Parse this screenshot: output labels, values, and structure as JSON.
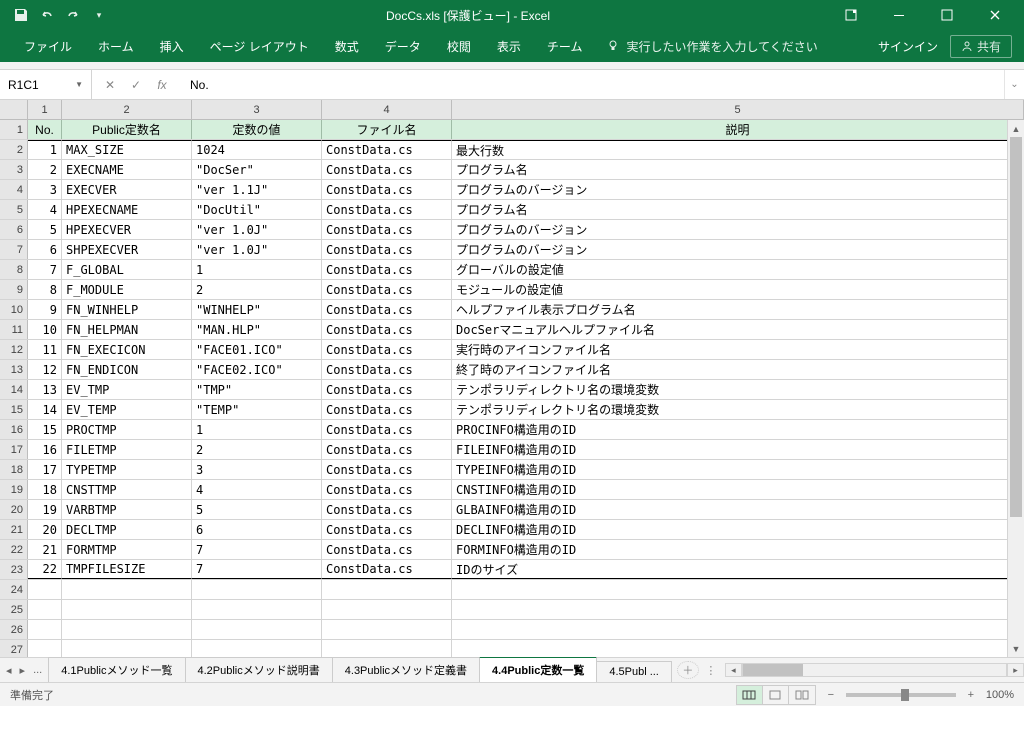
{
  "title": "DocCs.xls  [保護ビュー] - Excel",
  "qat": {
    "save": "保存",
    "undo": "元に戻す",
    "redo": "やり直し"
  },
  "ribbon": {
    "tabs": [
      "ファイル",
      "ホーム",
      "挿入",
      "ページ レイアウト",
      "数式",
      "データ",
      "校閲",
      "表示",
      "チーム"
    ],
    "tellme": "実行したい作業を入力してください",
    "signin": "サインイン",
    "share": "共有"
  },
  "name_box": "R1C1",
  "formula": "No.",
  "columns": [
    "1",
    "2",
    "3",
    "4",
    "5"
  ],
  "headers": [
    "No.",
    "Public定数名",
    "定数の値",
    "ファイル名",
    "説明"
  ],
  "rows": [
    {
      "no": "1",
      "name": "MAX_SIZE",
      "value": "1024",
      "file": "ConstData.cs",
      "desc": "最大行数"
    },
    {
      "no": "2",
      "name": "EXECNAME",
      "value": "\"DocSer\"",
      "file": "ConstData.cs",
      "desc": "プログラム名"
    },
    {
      "no": "3",
      "name": "EXECVER",
      "value": "\"ver 1.1J\"",
      "file": "ConstData.cs",
      "desc": "プログラムのバージョン"
    },
    {
      "no": "4",
      "name": "HPEXECNAME",
      "value": "\"DocUtil\"",
      "file": "ConstData.cs",
      "desc": "プログラム名"
    },
    {
      "no": "5",
      "name": "HPEXECVER",
      "value": "\"ver 1.0J\"",
      "file": "ConstData.cs",
      "desc": "プログラムのバージョン"
    },
    {
      "no": "6",
      "name": "SHPEXECVER",
      "value": "\"ver 1.0J\"",
      "file": "ConstData.cs",
      "desc": "プログラムのバージョン"
    },
    {
      "no": "7",
      "name": "F_GLOBAL",
      "value": "1",
      "file": "ConstData.cs",
      "desc": "グローバルの設定値"
    },
    {
      "no": "8",
      "name": "F_MODULE",
      "value": "2",
      "file": "ConstData.cs",
      "desc": "モジュールの設定値"
    },
    {
      "no": "9",
      "name": "FN_WINHELP",
      "value": "\"WINHELP\"",
      "file": "ConstData.cs",
      "desc": "ヘルプファイル表示プログラム名"
    },
    {
      "no": "10",
      "name": "FN_HELPMAN",
      "value": "\"MAN.HLP\"",
      "file": "ConstData.cs",
      "desc": "DocSerマニュアルヘルプファイル名"
    },
    {
      "no": "11",
      "name": "FN_EXECICON",
      "value": "\"FACE01.ICO\"",
      "file": "ConstData.cs",
      "desc": "実行時のアイコンファイル名"
    },
    {
      "no": "12",
      "name": "FN_ENDICON",
      "value": "\"FACE02.ICO\"",
      "file": "ConstData.cs",
      "desc": "終了時のアイコンファイル名"
    },
    {
      "no": "13",
      "name": "EV_TMP",
      "value": "\"TMP\"",
      "file": "ConstData.cs",
      "desc": "テンポラリディレクトリ名の環境変数"
    },
    {
      "no": "14",
      "name": "EV_TEMP",
      "value": "\"TEMP\"",
      "file": "ConstData.cs",
      "desc": "テンポラリディレクトリ名の環境変数"
    },
    {
      "no": "15",
      "name": "PROCTMP",
      "value": "1",
      "file": "ConstData.cs",
      "desc": "PROCINFO構造用のID"
    },
    {
      "no": "16",
      "name": "FILETMP",
      "value": "2",
      "file": "ConstData.cs",
      "desc": "FILEINFO構造用のID"
    },
    {
      "no": "17",
      "name": "TYPETMP",
      "value": "3",
      "file": "ConstData.cs",
      "desc": "TYPEINFO構造用のID"
    },
    {
      "no": "18",
      "name": "CNSTTMP",
      "value": "4",
      "file": "ConstData.cs",
      "desc": "CNSTINFO構造用のID"
    },
    {
      "no": "19",
      "name": "VARBTMP",
      "value": "5",
      "file": "ConstData.cs",
      "desc": "GLBAINFO構造用のID"
    },
    {
      "no": "20",
      "name": "DECLTMP",
      "value": "6",
      "file": "ConstData.cs",
      "desc": "DECLINFO構造用のID"
    },
    {
      "no": "21",
      "name": "FORMTMP",
      "value": "7",
      "file": "ConstData.cs",
      "desc": "FORMINFO構造用のID"
    },
    {
      "no": "22",
      "name": "TMPFILESIZE",
      "value": "7",
      "file": "ConstData.cs",
      "desc": "IDのサイズ"
    }
  ],
  "empty_rows": [
    "24",
    "25",
    "26",
    "27"
  ],
  "sheet_tabs": {
    "more": "...",
    "items": [
      "4.1Publicメソッド一覧",
      "4.2Publicメソッド説明書",
      "4.3Publicメソッド定義書",
      "4.4Public定数一覧",
      "4.5Publ ..."
    ],
    "active_index": 3
  },
  "status": {
    "ready": "準備完了",
    "zoom": "100%"
  }
}
